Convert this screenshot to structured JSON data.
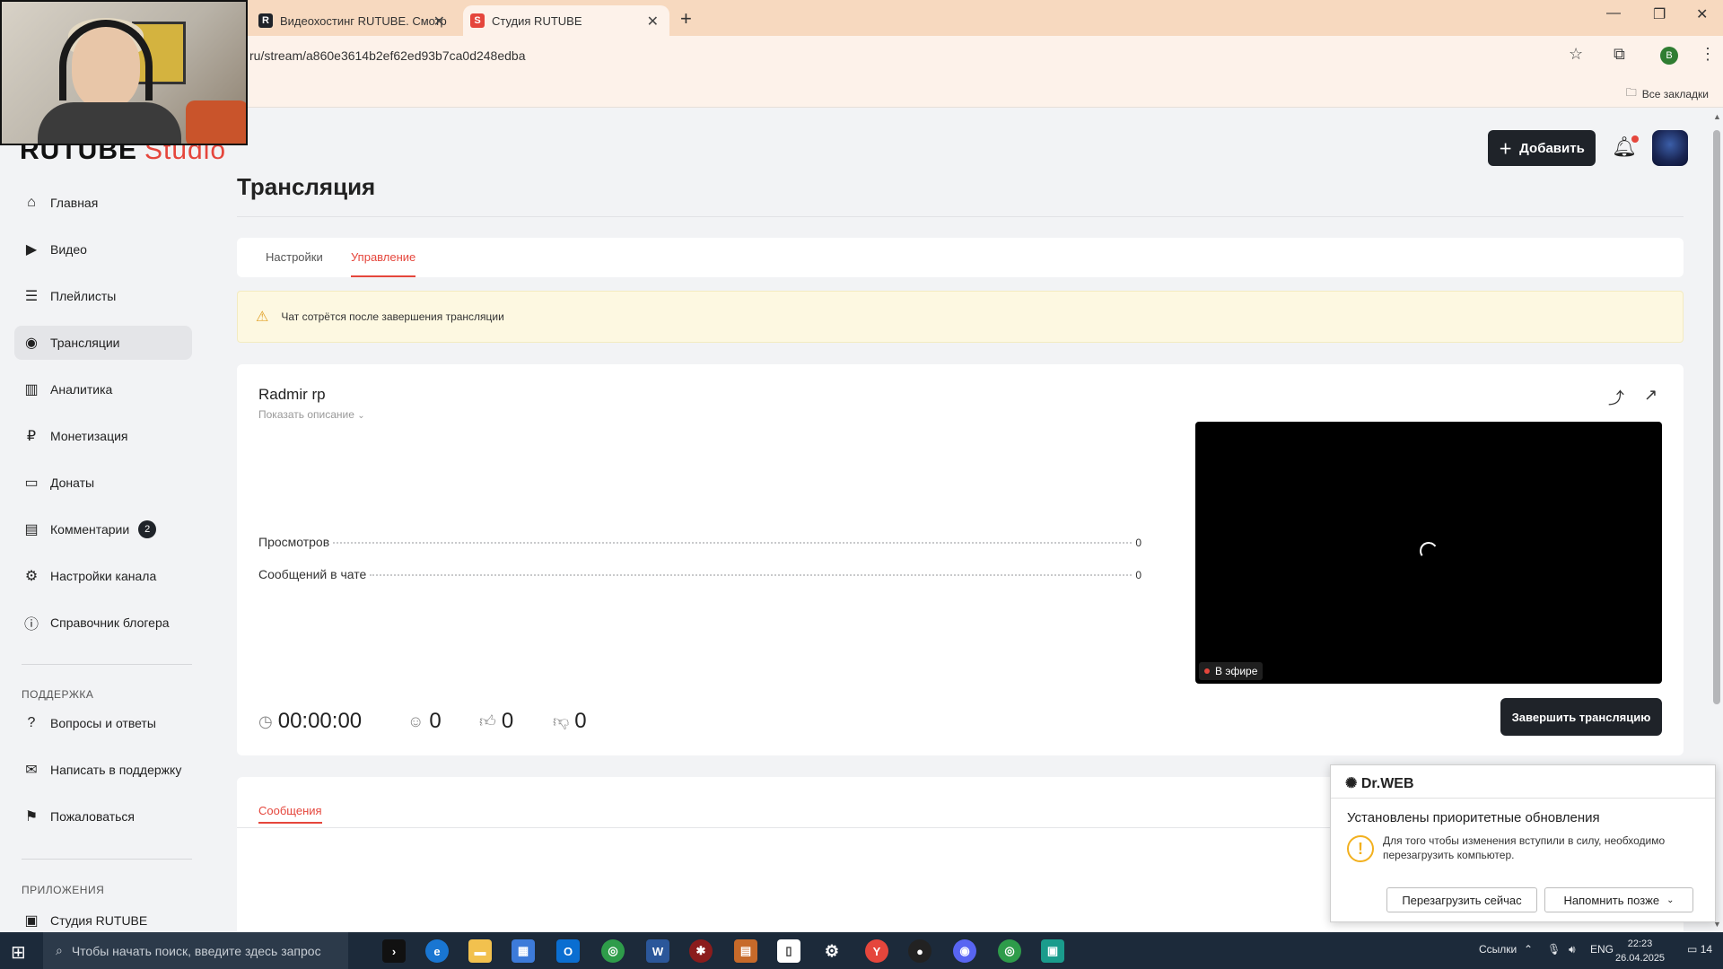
{
  "browser": {
    "tabs": [
      {
        "title": "Видеохостинг RUTUBE. Смотр",
        "favicon": "rutube-favicon",
        "active": false
      },
      {
        "title": "Студия RUTUBE",
        "favicon": "rutube-studio-favicon",
        "active": true
      }
    ],
    "url": "ru/stream/a860e3614b2ef62ed93b7ca0d248edba",
    "profile_initial": "B",
    "all_bookmarks": "Все закладки"
  },
  "header": {
    "logo_main": "RUTUBE",
    "logo_sub": "Studio",
    "add_button": "Добавить"
  },
  "sidebar": {
    "items": [
      {
        "label": "Главная",
        "icon": "home-icon"
      },
      {
        "label": "Видео",
        "icon": "video-icon"
      },
      {
        "label": "Плейлисты",
        "icon": "playlist-icon"
      },
      {
        "label": "Трансляции",
        "icon": "broadcast-icon",
        "active": true
      },
      {
        "label": "Аналитика",
        "icon": "analytics-icon"
      },
      {
        "label": "Монетизация",
        "icon": "ruble-icon"
      },
      {
        "label": "Донаты",
        "icon": "wallet-icon"
      },
      {
        "label": "Комментарии",
        "icon": "comment-icon",
        "badge": "2"
      },
      {
        "label": "Настройки канала",
        "icon": "gear-icon"
      },
      {
        "label": "Справочник блогера",
        "icon": "info-icon"
      }
    ],
    "support_heading": "ПОДДЕРЖКА",
    "support_items": [
      {
        "label": "Вопросы и ответы",
        "icon": "question-icon"
      },
      {
        "label": "Написать в поддержку",
        "icon": "mail-icon"
      },
      {
        "label": "Пожаловаться",
        "icon": "flag-icon"
      }
    ],
    "apps_heading": "ПРИЛОЖЕНИЯ",
    "apps_items": [
      {
        "label": "Студия RUTUBE",
        "icon": "app-icon"
      }
    ]
  },
  "main": {
    "title": "Трансляция",
    "tabs": [
      {
        "label": "Настройки",
        "active": false
      },
      {
        "label": "Управление",
        "active": true
      }
    ],
    "warning": "Чат сотрётся после завершения трансляции",
    "stream": {
      "name": "Radmir rp",
      "show_description": "Показать описание",
      "stats": [
        {
          "label": "Просмотров",
          "value": "0"
        },
        {
          "label": "Сообщений в чате",
          "value": "0"
        }
      ],
      "live_label": "В эфире",
      "duration": "00:00:00",
      "viewers": "0",
      "likes": "0",
      "dislikes": "0",
      "end_button": "Завершить трансляцию"
    },
    "messages_tab": "Сообщения"
  },
  "drweb": {
    "brand": "Dr.WEB",
    "title": "Установлены приоритетные обновления",
    "message": "Для того чтобы изменения вступили в силу, необходимо перезагрузить компьютер.",
    "restart_button": "Перезагрузить сейчас",
    "remind_button": "Напомнить позже"
  },
  "taskbar": {
    "search_placeholder": "Чтобы начать поиск, введите здесь запрос",
    "links_label": "Ссылки",
    "language": "ENG",
    "time": "22:23",
    "date": "26.04.2025",
    "notifications": "14"
  },
  "colors": {
    "accent": "#e5463c",
    "dark_button": "#1f2329",
    "warning_bg": "#fdf8e1",
    "taskbar": "#1c2a3a"
  }
}
